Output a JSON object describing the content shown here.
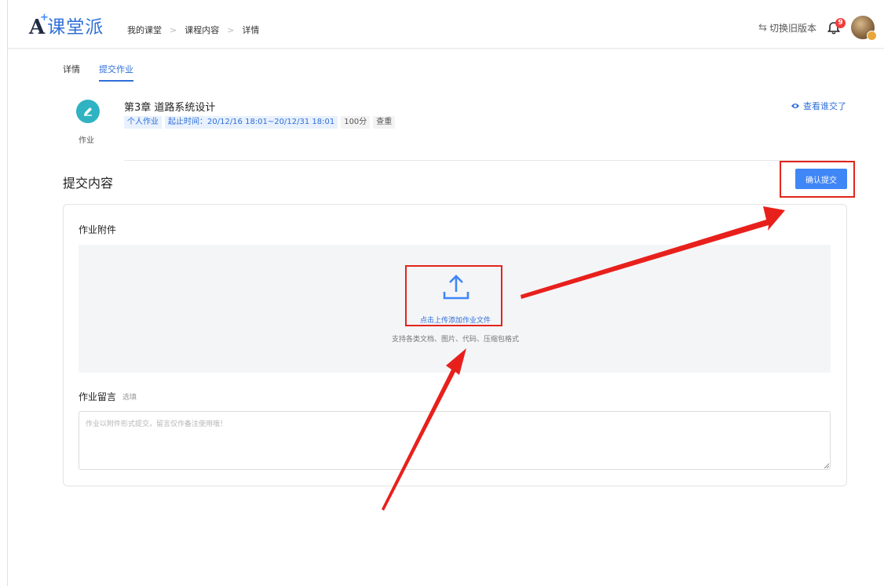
{
  "header": {
    "logo_text": "课堂派",
    "breadcrumb": [
      "我的课堂",
      "课程内容",
      "详情"
    ],
    "switch_version": "切换旧版本",
    "notification_count": "9"
  },
  "tabs": [
    "详情",
    "提交作业"
  ],
  "assignment": {
    "icon_label": "作业",
    "title": "第3章 道路系统设计",
    "tag_type": "个人作业",
    "tag_time": "起止时间：20/12/16 18:01~20/12/31 18:01",
    "tag_score": "100分",
    "tag_check": "查重",
    "view_submitted": "查看谁交了"
  },
  "submit": {
    "section_title": "提交内容",
    "confirm_button": "确认提交"
  },
  "attachment": {
    "label": "作业附件",
    "upload_link": "点击上传添加作业文件",
    "upload_hint": "支持各类文档、图片、代码、压缩包格式"
  },
  "message": {
    "label": "作业留言",
    "optional": "选填",
    "placeholder": "作业以附件形式提交，留言仅作备注使用哦！",
    "value": ""
  },
  "colors": {
    "accent": "#3f86f7",
    "annotation_red": "#e3241b",
    "icon_teal": "#2fb3c2"
  }
}
